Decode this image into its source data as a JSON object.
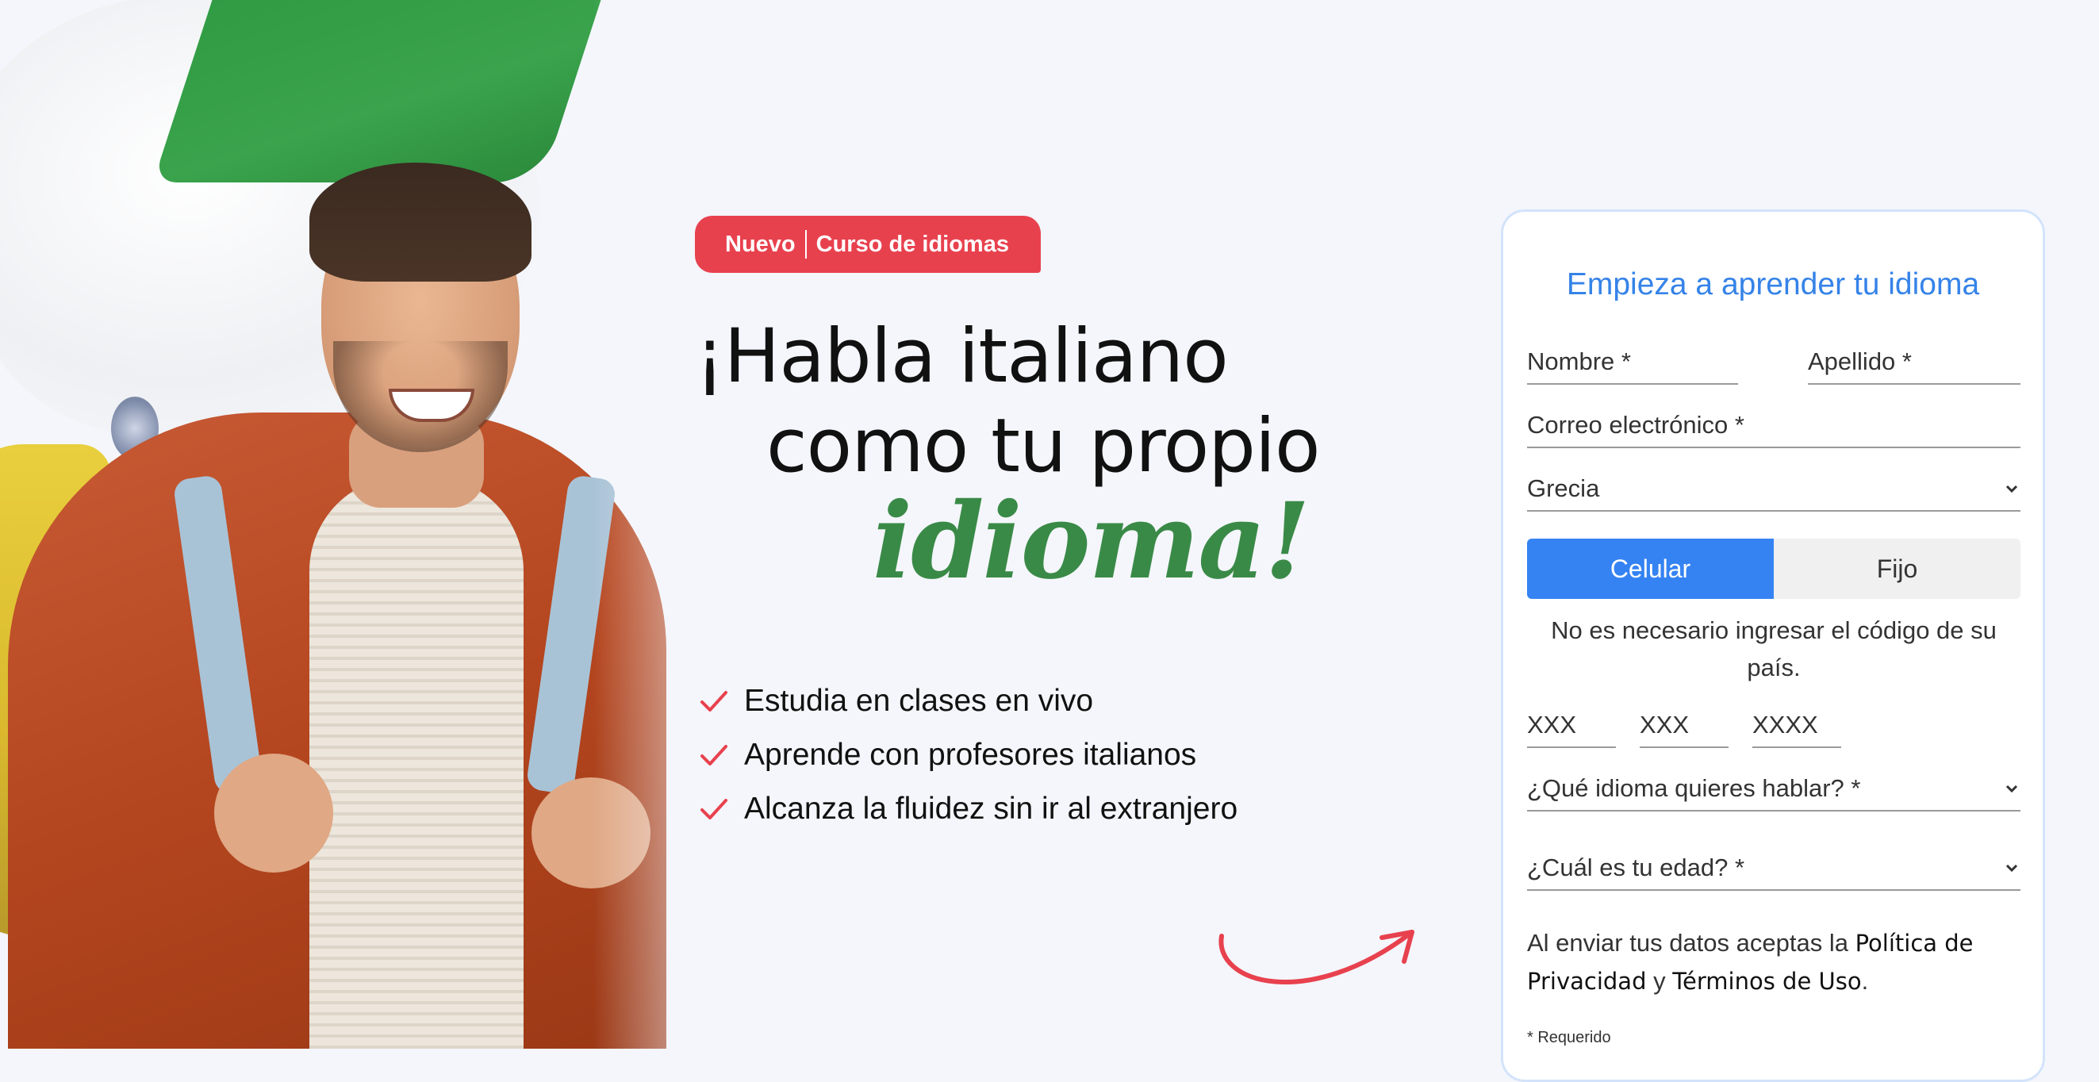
{
  "hero": {
    "badge": {
      "left": "Nuevo",
      "right": "Curso de idiomas"
    },
    "headline_line1": "¡Habla italiano",
    "headline_line2": "como tu propio",
    "headline_emphasis": "idioma!",
    "benefits": [
      "Estudia en clases en vivo",
      "Aprende con profesores italianos",
      "Alcanza la fluidez sin ir al extranjero"
    ]
  },
  "form": {
    "title": "Empieza a aprender tu idioma",
    "first_name_placeholder": "Nombre *",
    "last_name_placeholder": "Apellido *",
    "email_placeholder": "Correo electrónico *",
    "country_selected": "Grecia",
    "phone_types": {
      "mobile": "Celular",
      "landline": "Fijo",
      "active": "mobile"
    },
    "country_code_note": "No es necesario ingresar el código de su país.",
    "phone_parts": [
      "XXX",
      "XXX",
      "XXXX"
    ],
    "language_select": "¿Qué idioma quieres hablar? *",
    "age_select": "¿Cuál es tu edad? *",
    "consent_prefix": "Al enviar tus datos aceptas la",
    "privacy_link": "Política de Privacidad",
    "consent_and": "y",
    "terms_link": "Términos de Uso",
    "consent_suffix": ".",
    "required_note": "* Requerido"
  },
  "colors": {
    "badge": "#e8414e",
    "accent_blue": "#3583f2",
    "title_blue": "#3583e8",
    "emphasis_green": "#3a8a47",
    "check_red": "#e8414e",
    "page_bg": "#f4f6fb"
  },
  "icons": [
    "check-icon",
    "chevron-down-icon",
    "curved-arrow-icon"
  ]
}
